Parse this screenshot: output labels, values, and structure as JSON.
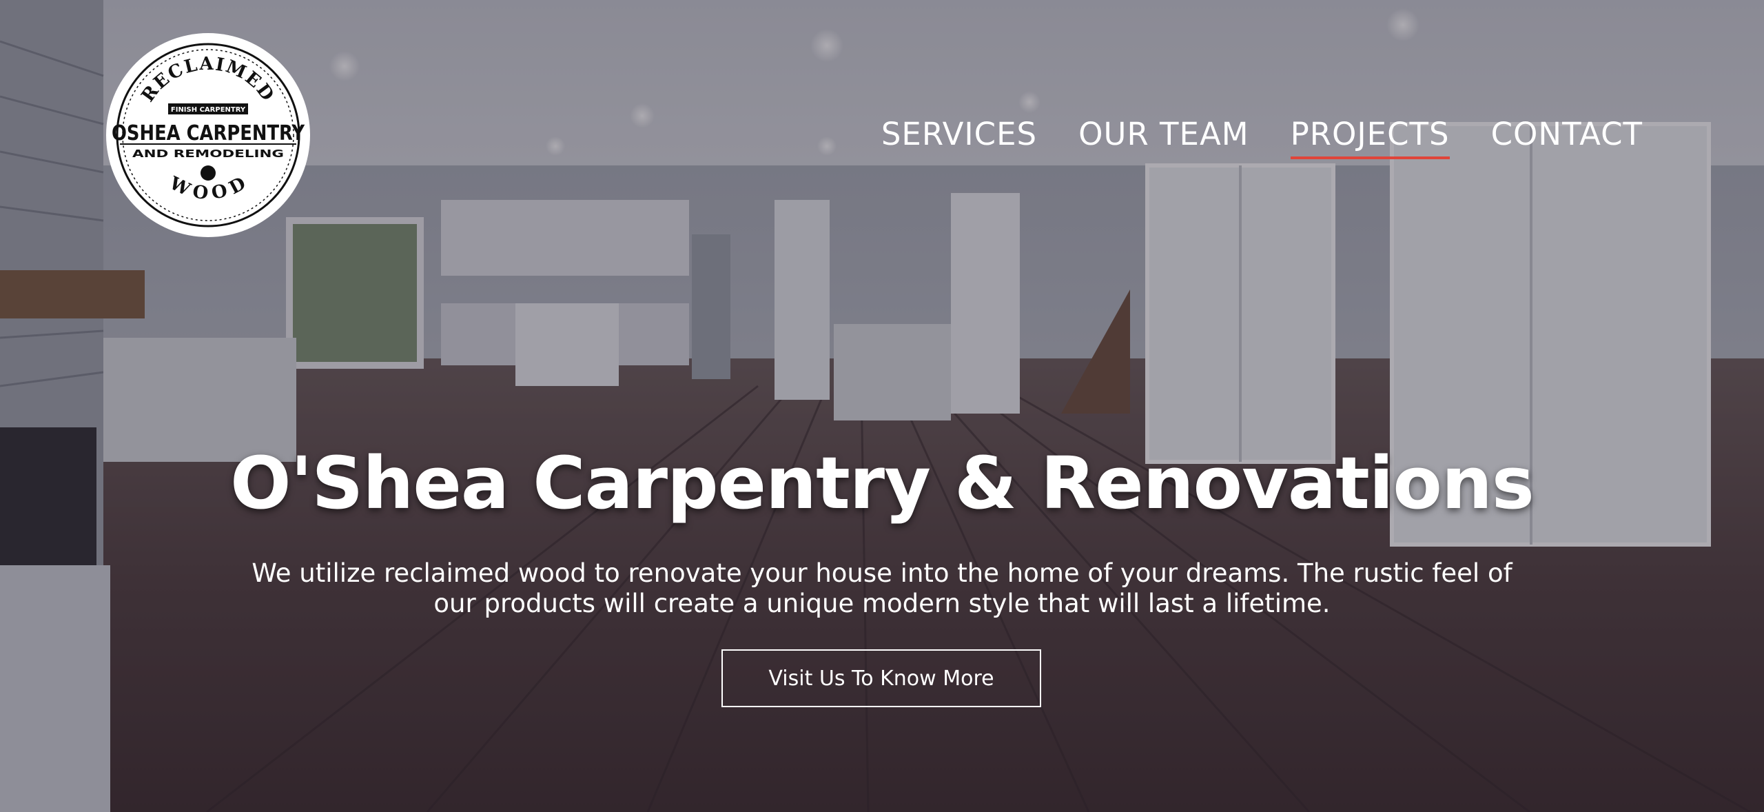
{
  "brand": {
    "logo_top_text": "RECLAIMED",
    "logo_badge_text": "FINISH CARPENTRY",
    "logo_main_text": "OSHEA CARPENTRY",
    "logo_sub_text": "AND REMODELING",
    "logo_bottom_text": "WOOD"
  },
  "nav": {
    "items": [
      {
        "label": "SERVICES",
        "active": false
      },
      {
        "label": "OUR TEAM",
        "active": false
      },
      {
        "label": "PROJECTS",
        "active": true
      },
      {
        "label": "CONTACT",
        "active": false
      }
    ],
    "active_underline_color": "#e0453a"
  },
  "hero": {
    "title": "O'Shea Carpentry & Renovations",
    "subtitle": "We utilize reclaimed wood to renovate your house into the home of your dreams. The rustic feel of our products will create a unique modern style that will last a lifetime.",
    "cta_label": "Visit Us To Know More"
  }
}
